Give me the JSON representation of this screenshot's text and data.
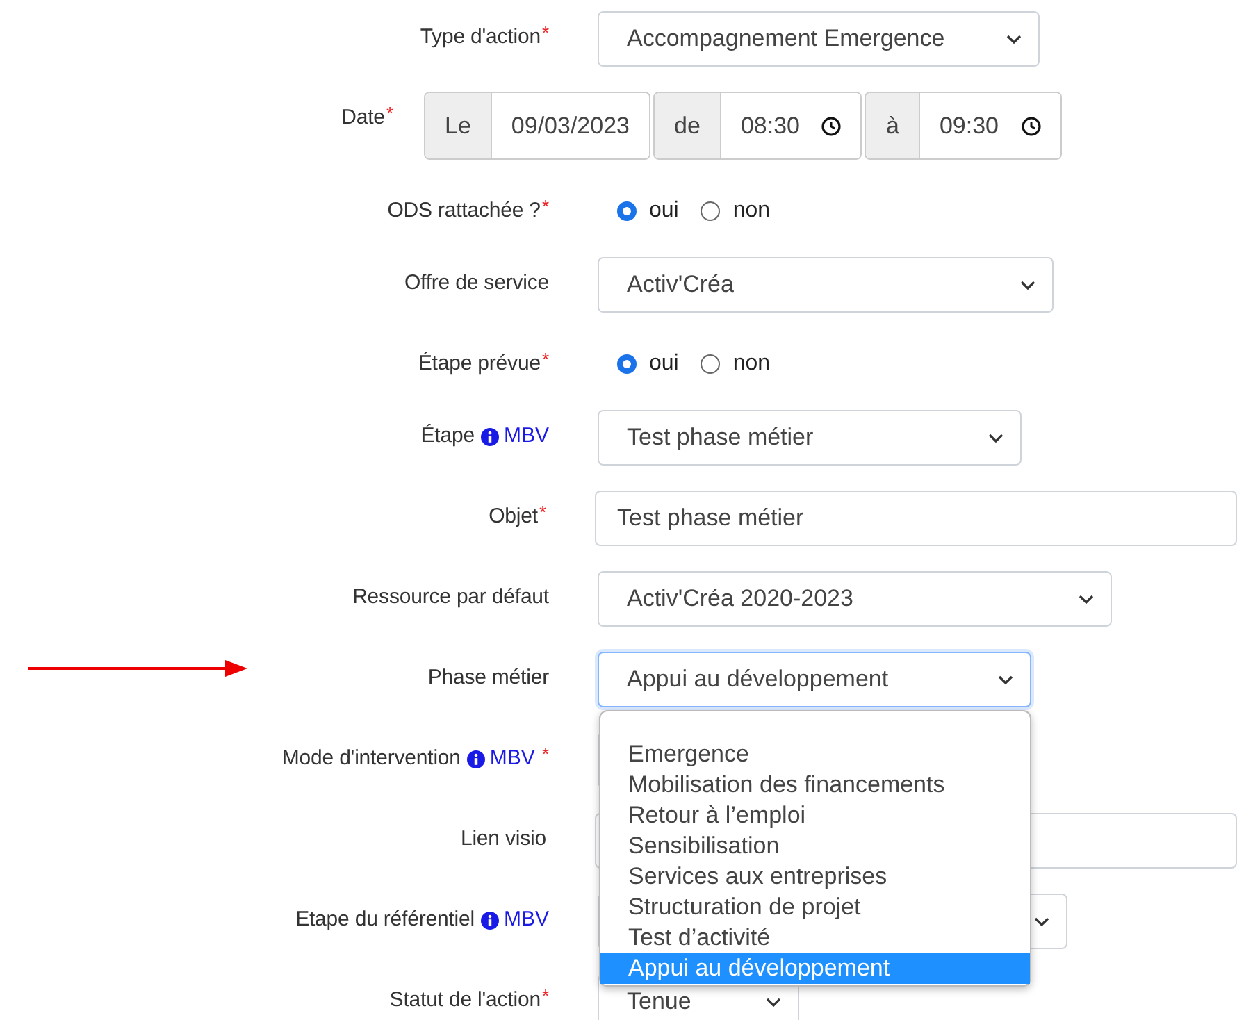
{
  "form": {
    "fields": [
      {
        "label": "Type d'action",
        "required_mark": "*",
        "kind": "select",
        "value": "Accompagnement Emergence"
      },
      {
        "label": "Date",
        "required_mark": "*",
        "kind": "daterange",
        "parts": [
          {
            "addon": "Le",
            "value": "09/03/2023",
            "clock": false
          },
          {
            "addon": "de",
            "value": "08:30",
            "clock": true
          },
          {
            "addon": "à",
            "value": "09:30",
            "clock": true
          }
        ]
      },
      {
        "label": "ODS rattachée ?",
        "required_mark": "*",
        "kind": "radio",
        "options": [
          {
            "label": "oui",
            "selected": true
          },
          {
            "label": "non",
            "selected": false
          }
        ]
      },
      {
        "label": "Offre de service",
        "kind": "select",
        "value": "Activ'Créa"
      },
      {
        "label": "Étape prévue",
        "required_mark": "*",
        "kind": "radio",
        "options": [
          {
            "label": "oui",
            "selected": true
          },
          {
            "label": "non",
            "selected": false
          }
        ]
      },
      {
        "label": "Étape",
        "info": "MBV",
        "kind": "select",
        "value": "Test phase métier"
      },
      {
        "label": "Objet",
        "required_mark": "*",
        "kind": "input",
        "value": "Test phase métier"
      },
      {
        "label": "Ressource par défaut",
        "kind": "select",
        "value": "Activ'Créa 2020-2023"
      },
      {
        "label": "Phase métier",
        "kind": "select",
        "value": "Appui au développement",
        "focused": true,
        "open": true,
        "options": [
          {
            "label": "Emergence",
            "selected": false
          },
          {
            "label": "Mobilisation des financements",
            "selected": false
          },
          {
            "label": "Retour à l’emploi",
            "selected": false
          },
          {
            "label": "Sensibilisation",
            "selected": false
          },
          {
            "label": "Services aux entreprises",
            "selected": false
          },
          {
            "label": "Structuration de projet",
            "selected": false
          },
          {
            "label": "Test d’activité",
            "selected": false
          },
          {
            "label": "Appui au développement",
            "selected": true
          }
        ]
      },
      {
        "label": "Mode d'intervention",
        "required_mark": "*",
        "info": "MBV",
        "kind": "select"
      },
      {
        "label": "Lien visio",
        "kind": "input"
      },
      {
        "label": "Etape du référentiel",
        "info": "MBV",
        "kind": "select"
      },
      {
        "label": "Statut de l'action",
        "required_mark": "*",
        "kind": "select",
        "value": "Tenue"
      }
    ]
  }
}
